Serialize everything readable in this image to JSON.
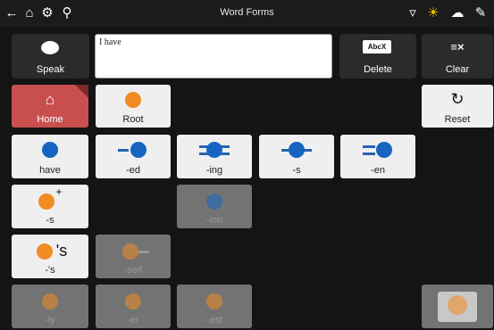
{
  "window": {
    "title": "Word Forms"
  },
  "status_icons": [
    "back-icon",
    "home-icon",
    "settings-icon",
    "search-icon",
    "filter-icon",
    "brightness-icon",
    "sync-icon",
    "edit-off-icon"
  ],
  "toolbar": {
    "speak_label": "Speak",
    "message_text": "I have",
    "delete_label": "Delete",
    "delete_key_text": "AbcX",
    "clear_label": "Clear"
  },
  "tiles": {
    "home": "Home",
    "root": "Root",
    "reset": "Reset",
    "have": "have",
    "ed": "-ed",
    "ing": "-ing",
    "s": "-s",
    "en": "-en",
    "s_plural": "-s",
    "ion": "-ion",
    "possessive": "-'s",
    "possessive_icon": "'s",
    "self": "-self",
    "ly": "-ly",
    "er": "-er",
    "est": "-est"
  },
  "colors": {
    "accent_blue": "#1565c0",
    "accent_orange": "#f08c22",
    "home_red": "#c94f4f"
  }
}
